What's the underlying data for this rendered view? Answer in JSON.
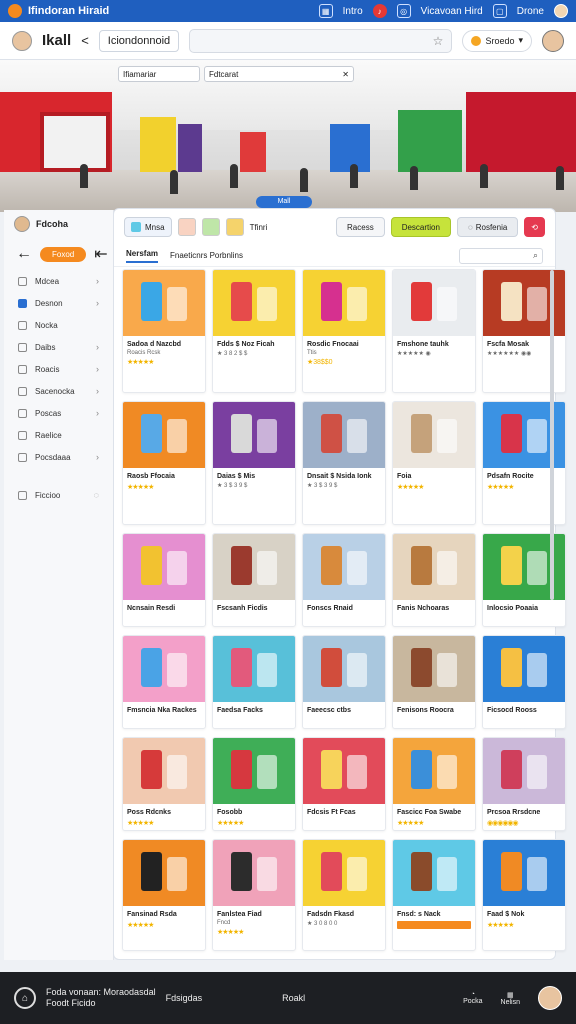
{
  "topbar": {
    "title": "Ifindoran Hiraid",
    "icons": [
      "grid-icon",
      "bell-icon",
      "globe-icon"
    ],
    "links": [
      "Intro",
      "Vicavoan Hird",
      "Drone"
    ]
  },
  "navbar": {
    "brand": "Ikall",
    "back": "<",
    "pill": "Iciondonnoid",
    "dropdown": "Sroedo"
  },
  "hero": {
    "tab1": "Ifiamariar",
    "tab2": "Fdtcarat",
    "badge": "Mall"
  },
  "sidebar": {
    "user": "Fdcoha",
    "action": "Foxod",
    "items": [
      {
        "label": "Mdcea"
      },
      {
        "label": "Desnon",
        "active": true
      },
      {
        "label": "Nocka"
      },
      {
        "label": "Daibs"
      },
      {
        "label": "Roacis"
      },
      {
        "label": "Sacenocka"
      },
      {
        "label": "Poscas"
      },
      {
        "label": "Raelice"
      },
      {
        "label": "Pocsdaaa"
      },
      {
        "label": "Ficcioo"
      }
    ]
  },
  "toolbar": {
    "chips": [
      "Mnsa",
      "Tfinri"
    ],
    "chip_colors": [
      "#f9d3c2",
      "#bfe6a8",
      "#f5d36b"
    ],
    "btn_secondary": "Racess",
    "btn_primary": "Descartion",
    "btn_grey": "Rosfenia"
  },
  "tabs": {
    "active": "Nersfam",
    "other": "Fnaeticnrs Porbnlins"
  },
  "products": [
    {
      "title": "Sadoa d Nazcbd",
      "sub": "Roacis Rcsk",
      "stars": "★★★★★",
      "bg": "#f9a94b",
      "accent": "#3aa7e6"
    },
    {
      "title": "Fdds $ Noz Ficah",
      "sub": "★ 3 8 2 $ $",
      "stars": "",
      "bg": "#f6d233",
      "accent": "#e64b4b"
    },
    {
      "title": "Rosdic Fnocaai",
      "sub": "Ttis",
      "stars": "★ 3 8 $ $ 0",
      "bg": "#f6d233",
      "accent": "#d6308f"
    },
    {
      "title": "Fmshone tauhk",
      "sub": "★★★★★ ◉",
      "stars": "",
      "bg": "#e9ecef",
      "accent": "#e23a3a"
    },
    {
      "title": "Fscfa Mosak",
      "sub": "★★★★★★ ◉◉",
      "stars": "",
      "bg": "#b73b23",
      "accent": "#f5e2c2"
    },
    {
      "title": "Raosb Ffocaia",
      "sub": "",
      "stars": "★★★★★",
      "bg": "#f08a24",
      "accent": "#58a9e6"
    },
    {
      "title": "Daias $ Mis",
      "sub": "★ 3 $ 3 9 $",
      "stars": "",
      "bg": "#7a3fa0",
      "accent": "#d9d9d9"
    },
    {
      "title": "Dnsait $ Nsida Ionk",
      "sub": "★ 3 $ 3 9 $",
      "stars": "",
      "bg": "#9db0c9",
      "accent": "#cf5145"
    },
    {
      "title": "Foia",
      "sub": "",
      "stars": "★★★★★",
      "bg": "#ece6de",
      "accent": "#c5a27b"
    },
    {
      "title": "Pdsafn Rocite",
      "sub": "",
      "stars": "★★★★★",
      "bg": "#3b92e3",
      "accent": "#d8344a"
    },
    {
      "title": "Ncnsain Resdi",
      "sub": "",
      "stars": "",
      "bg": "#e58fd0",
      "accent": "#f2c230"
    },
    {
      "title": "Fscsanh Ficdis",
      "sub": "",
      "stars": "",
      "bg": "#d8d2c6",
      "accent": "#9b3a2e"
    },
    {
      "title": "Fonscs Rnaid",
      "sub": "",
      "stars": "",
      "bg": "#b9d0e6",
      "accent": "#d88a3c"
    },
    {
      "title": "Fanis Nchoaras",
      "sub": "",
      "stars": "",
      "bg": "#e6d5be",
      "accent": "#b87a3f"
    },
    {
      "title": "Inlocsio Poaaia",
      "sub": "",
      "stars": "",
      "bg": "#38a84a",
      "accent": "#f3d24a"
    },
    {
      "title": "Fmsncia Nka Rackes",
      "sub": "",
      "stars": "",
      "bg": "#f3a0c9",
      "accent": "#4aa3e6"
    },
    {
      "title": "Faedsa Facks",
      "sub": "",
      "stars": "",
      "bg": "#58c0d9",
      "accent": "#e25a7c"
    },
    {
      "title": "Faeecsc ctbs",
      "sub": "",
      "stars": "",
      "bg": "#a9c7de",
      "accent": "#d14d3c"
    },
    {
      "title": "Fenisons Roocra",
      "sub": "",
      "stars": "",
      "bg": "#c8b79e",
      "accent": "#8c4a2e"
    },
    {
      "title": "Ficsocd Rooss",
      "sub": "",
      "stars": "",
      "bg": "#2a7fd6",
      "accent": "#f5c043"
    },
    {
      "title": "Poss Rdcnks",
      "sub": "",
      "stars": "★★★★★",
      "bg": "#f1c9b0",
      "accent": "#d63a3a"
    },
    {
      "title": "Fosobb",
      "sub": "",
      "stars": "★★★★★",
      "bg": "#3fae57",
      "accent": "#d6383f"
    },
    {
      "title": "Fdcsis Ft Fcas",
      "sub": "",
      "stars": "",
      "bg": "#e24b5a",
      "accent": "#f7d35b"
    },
    {
      "title": "Fascicc Foa Swabe",
      "sub": "",
      "stars": "★★★★★",
      "bg": "#f4a53c",
      "accent": "#3b8fd9"
    },
    {
      "title": "Prcsoa Rrsdcne",
      "sub": "",
      "stars": "◉◉◉◉◉◉",
      "bg": "#cbb8d9",
      "accent": "#cf3f5c"
    },
    {
      "title": "Fansinad Rsda",
      "sub": "",
      "stars": "★★★★★",
      "bg": "#f08a24",
      "accent": "#222222"
    },
    {
      "title": "Fanlstea Fiad",
      "sub": "Fncd",
      "stars": "★★★★★",
      "bg": "#f0a2b9",
      "accent": "#2c2c2c"
    },
    {
      "title": "Fadsdn Fkasd",
      "sub": "★ 3 0 8 0 0",
      "stars": "",
      "bg": "#f6d233",
      "accent": "#e24b5a"
    },
    {
      "title": "Fnsd: s Nack",
      "sub": "",
      "stars": "",
      "bg": "#5fc9e6",
      "accent": "#8a4b2b"
    },
    {
      "title": "Faad $ Nok",
      "sub": "",
      "stars": "★★★★★",
      "bg": "#2a7fd6",
      "accent": "#f08a24"
    }
  ],
  "bottombar": {
    "line1": "Foda vonaan: Moraodasdal",
    "line2": "Foodt Ficido",
    "mid": "Fdsigdas",
    "center": "Roakl",
    "icons": [
      "Pocka",
      "Nelisn"
    ]
  }
}
